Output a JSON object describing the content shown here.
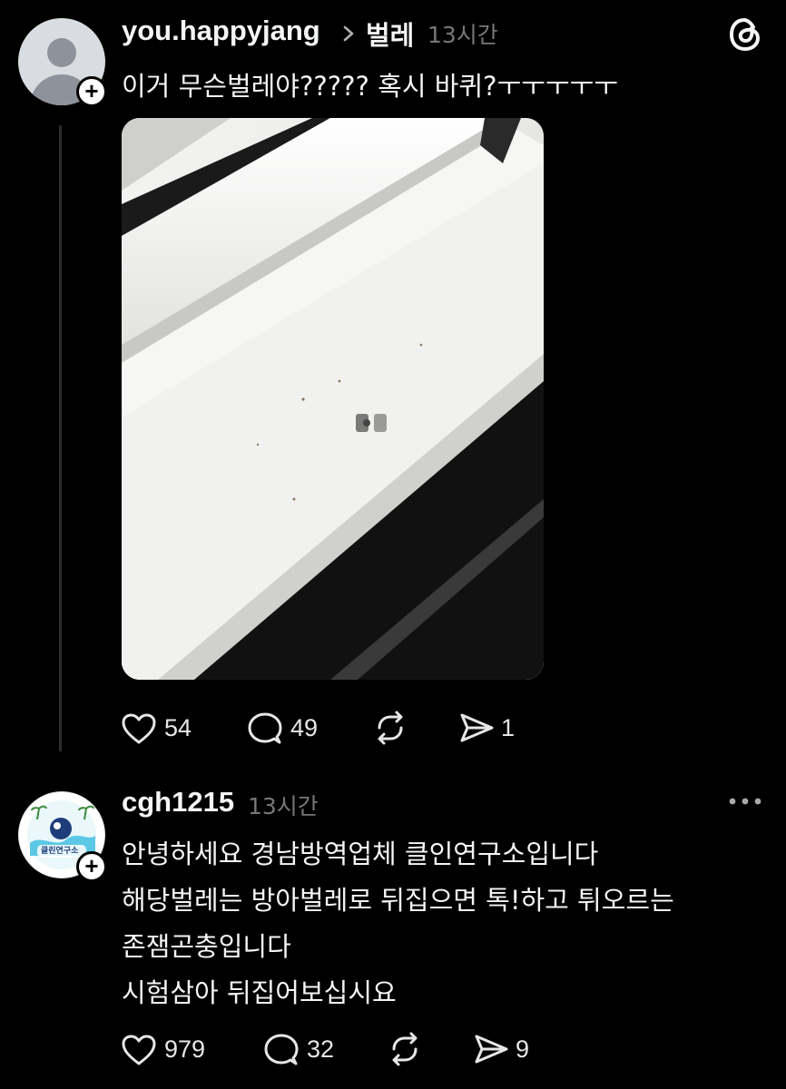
{
  "post": {
    "username": "you.happyjang",
    "community": "벌레",
    "time": "13시간",
    "text": "이거 무슨벌레야????? 혹시 바퀴?ㅜㅜㅜㅜㅜ",
    "image_icon": "photo-of-white-window-frame-with-small-bug",
    "actions": {
      "likes": "54",
      "comments": "49",
      "shares": "1"
    }
  },
  "reply": {
    "username": "cgh1215",
    "time": "13시간",
    "avatar_text": "클린연구소",
    "lines": [
      "안녕하세요 경남방역업체 클인연구소입니다",
      "해당벌레는 방아벌레로 뒤집으면 톡!하고 튀오르는",
      "존잼곤충입니다",
      "시험삼아 뒤집어보십시요"
    ],
    "actions": {
      "likes": "979",
      "comments": "32",
      "shares": "9"
    }
  },
  "colors": {
    "background": "#000000",
    "text": "#f3f5f7",
    "muted": "#777777",
    "thread_line": "#2e2e2e"
  }
}
